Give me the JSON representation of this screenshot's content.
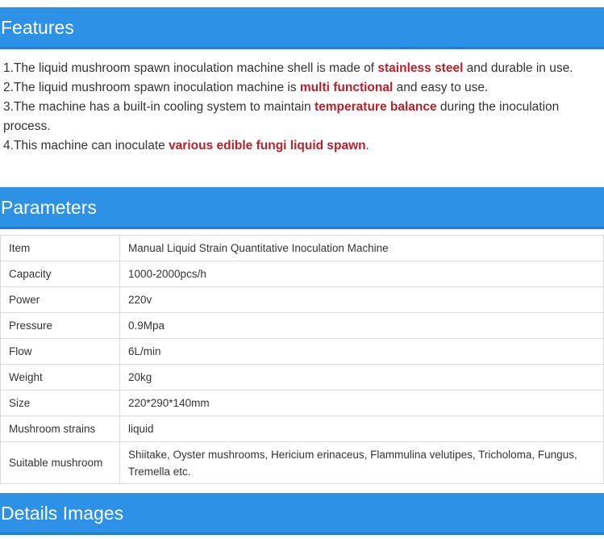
{
  "sections": {
    "features": "Features",
    "parameters": "Parameters",
    "details": "Details Images"
  },
  "features": [
    {
      "pre": "1.The liquid mushroom spawn inoculation machine shell is made of ",
      "hl": "stainless steel",
      "post": " and durable in use."
    },
    {
      "pre": "2.The liquid mushroom spawn inoculation machine is ",
      "hl": "multi functional",
      "post": " and easy to use."
    },
    {
      "pre": "3.The machine has a built-in cooling system to maintain ",
      "hl": "temperature balance",
      "post": " during the inoculation process."
    },
    {
      "pre": "4.This machine can inoculate ",
      "hl": "various edible fungi liquid spawn",
      "post": "."
    }
  ],
  "params": [
    {
      "k": "Item",
      "v": "Manual Liquid Strain Quantitative Inoculation Machine"
    },
    {
      "k": "Capacity",
      "v": "1000-2000pcs/h"
    },
    {
      "k": "Power",
      "v": "220v"
    },
    {
      "k": "Pressure",
      "v": "0.9Mpa"
    },
    {
      "k": "Flow",
      "v": "6L/min"
    },
    {
      "k": "Weight",
      "v": "20kg"
    },
    {
      "k": "Size",
      "v": "220*290*140mm"
    },
    {
      "k": "Mushroom strains",
      "v": "liquid"
    },
    {
      "k": "Suitable mushroom",
      "v": "Shiitake, Oyster mushrooms, Hericium erinaceus, Flammulina velutipes, Tricholoma, Fungus, Tremella etc."
    }
  ],
  "colors": {
    "header_bg": "#2d92e6",
    "highlight": "#b8212b"
  }
}
